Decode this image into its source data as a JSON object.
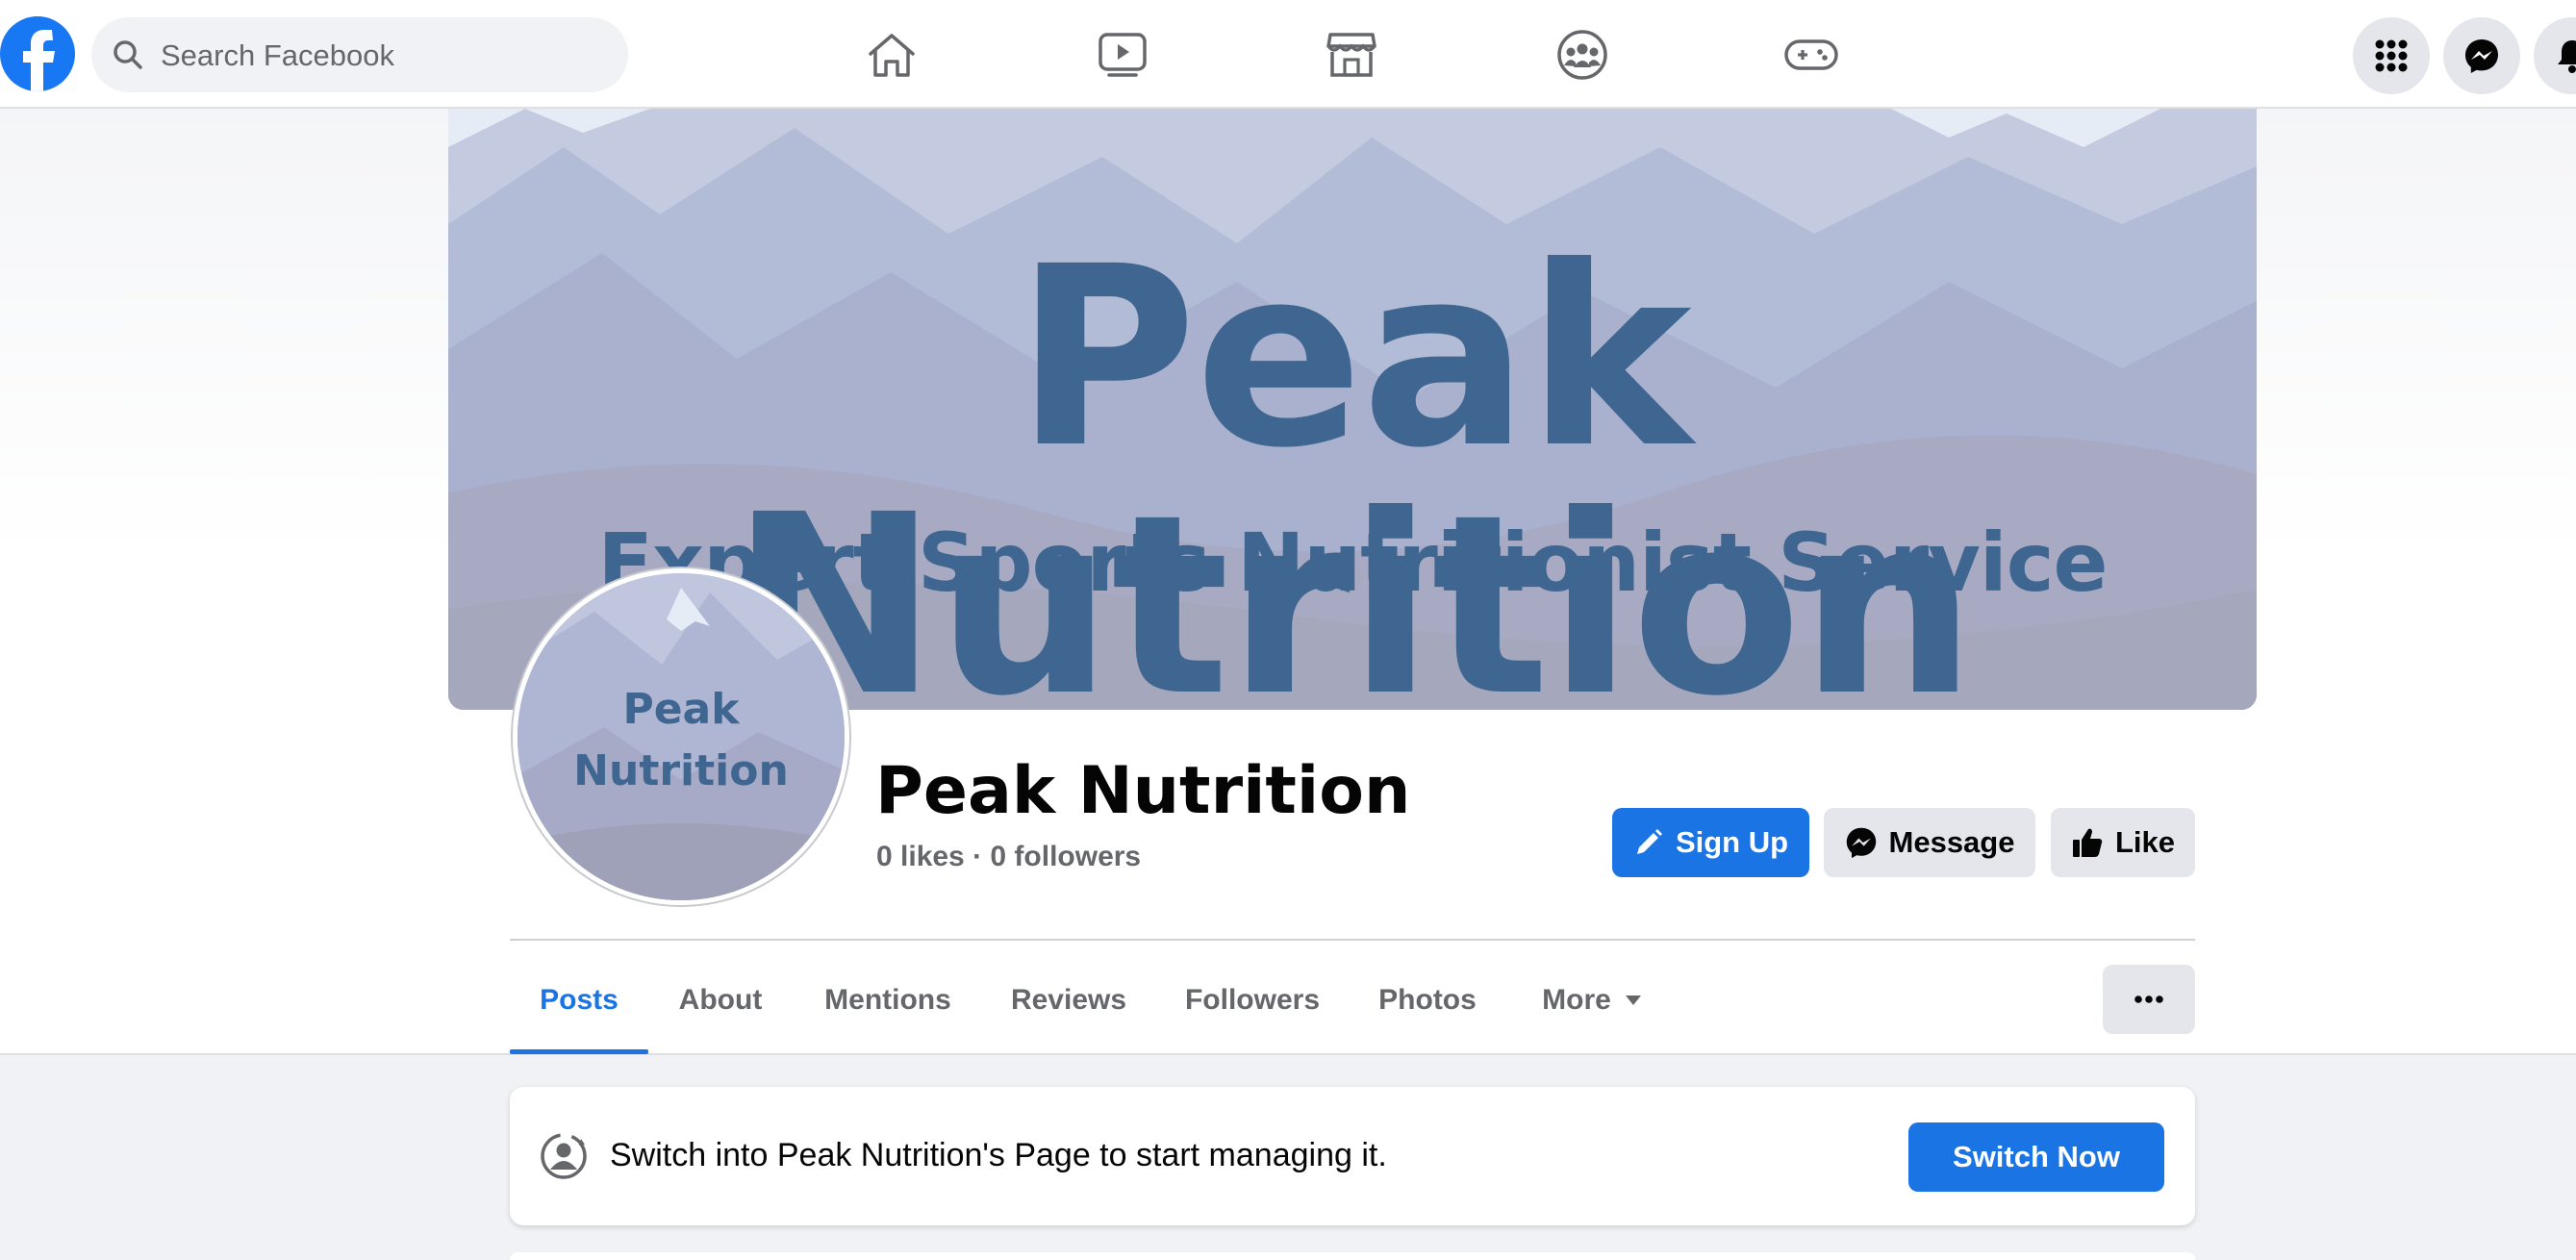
{
  "search": {
    "placeholder": "Search Facebook"
  },
  "nav": {
    "icons": [
      "home-icon",
      "watch-icon",
      "marketplace-icon",
      "groups-icon",
      "gaming-icon"
    ],
    "right": [
      "menu-grid-icon",
      "messenger-icon",
      "notifications-icon"
    ]
  },
  "cover": {
    "title": "Peak Nutrition",
    "subtitle": "Expert Sports Nutritionist Service"
  },
  "avatar": {
    "line1": "Peak",
    "line2": "Nutrition"
  },
  "page": {
    "name": "Peak Nutrition",
    "stats": "0 likes · 0 followers"
  },
  "actions": {
    "sign_up": "Sign Up",
    "message": "Message",
    "like": "Like"
  },
  "tabs": [
    {
      "label": "Posts",
      "active": true
    },
    {
      "label": "About"
    },
    {
      "label": "Mentions"
    },
    {
      "label": "Reviews"
    },
    {
      "label": "Followers"
    },
    {
      "label": "Photos"
    },
    {
      "label": "More"
    }
  ],
  "switch_card": {
    "text": "Switch into Peak Nutrition's Page to start managing it.",
    "button": "Switch Now"
  },
  "colors": {
    "brand": "#1877f2",
    "primary_button": "#1b74e4",
    "secondary_button": "#e4e6eb",
    "cover_text": "#3f6690"
  }
}
